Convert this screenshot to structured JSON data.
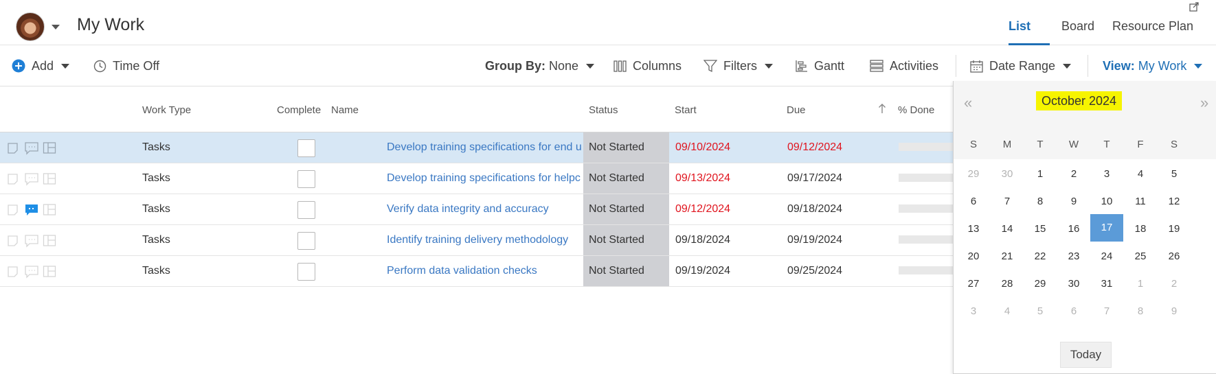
{
  "header": {
    "title": "My Work",
    "tabs": [
      {
        "label": "List",
        "active": true
      },
      {
        "label": "Board",
        "active": false
      },
      {
        "label": "Resource Plan",
        "active": false
      }
    ]
  },
  "toolbar": {
    "add_label": "Add",
    "time_off_label": "Time Off",
    "group_by_label": "Group By:",
    "group_by_value": "None",
    "columns_label": "Columns",
    "filters_label": "Filters",
    "gantt_label": "Gantt",
    "activities_label": "Activities",
    "date_range_label": "Date Range",
    "view_label": "View:",
    "view_value": "My Work"
  },
  "grid": {
    "headers": {
      "work_type": "Work Type",
      "complete": "Complete",
      "name": "Name",
      "status": "Status",
      "start": "Start",
      "due": "Due",
      "percent_done": "% Done"
    },
    "rows": [
      {
        "work_type": "Tasks",
        "name": "Develop training specifications for end u",
        "status": "Not Started",
        "start": "09/10/2024",
        "due": "09/12/2024"
      },
      {
        "work_type": "Tasks",
        "name": "Develop training specifications for helpc",
        "status": "Not Started",
        "start": "09/13/2024",
        "due": "09/17/2024"
      },
      {
        "work_type": "Tasks",
        "name": "Verify data integrity and accuracy",
        "status": "Not Started",
        "start": "09/12/2024",
        "due": "09/18/2024"
      },
      {
        "work_type": "Tasks",
        "name": "Identify training delivery methodology",
        "status": "Not Started",
        "start": "09/18/2024",
        "due": "09/19/2024"
      },
      {
        "work_type": "Tasks",
        "name": "Perform data validation checks",
        "status": "Not Started",
        "start": "09/19/2024",
        "due": "09/25/2024"
      }
    ]
  },
  "calendar": {
    "prev_label": "«",
    "next_label": "»",
    "month_label": "October 2024",
    "weekdays": [
      "S",
      "M",
      "T",
      "W",
      "T",
      "F",
      "S"
    ],
    "weeks": [
      [
        "29",
        "30",
        "1",
        "2",
        "3",
        "4",
        "5"
      ],
      [
        "6",
        "7",
        "8",
        "9",
        "10",
        "11",
        "12"
      ],
      [
        "13",
        "14",
        "15",
        "16",
        "17",
        "18",
        "19"
      ],
      [
        "20",
        "21",
        "22",
        "23",
        "24",
        "25",
        "26"
      ],
      [
        "27",
        "28",
        "29",
        "30",
        "31",
        "1",
        "2"
      ],
      [
        "3",
        "4",
        "5",
        "6",
        "7",
        "8",
        "9"
      ]
    ],
    "selected_day": "17",
    "today_label": "Today"
  },
  "colors": {
    "accent": "#1f6fb5",
    "overdue": "#e0141e",
    "selected_row": "#d7e7f5",
    "status_bg": "#cfd0d4",
    "calendar_selected": "#5b9bd8",
    "month_highlight": "#f6f400"
  }
}
